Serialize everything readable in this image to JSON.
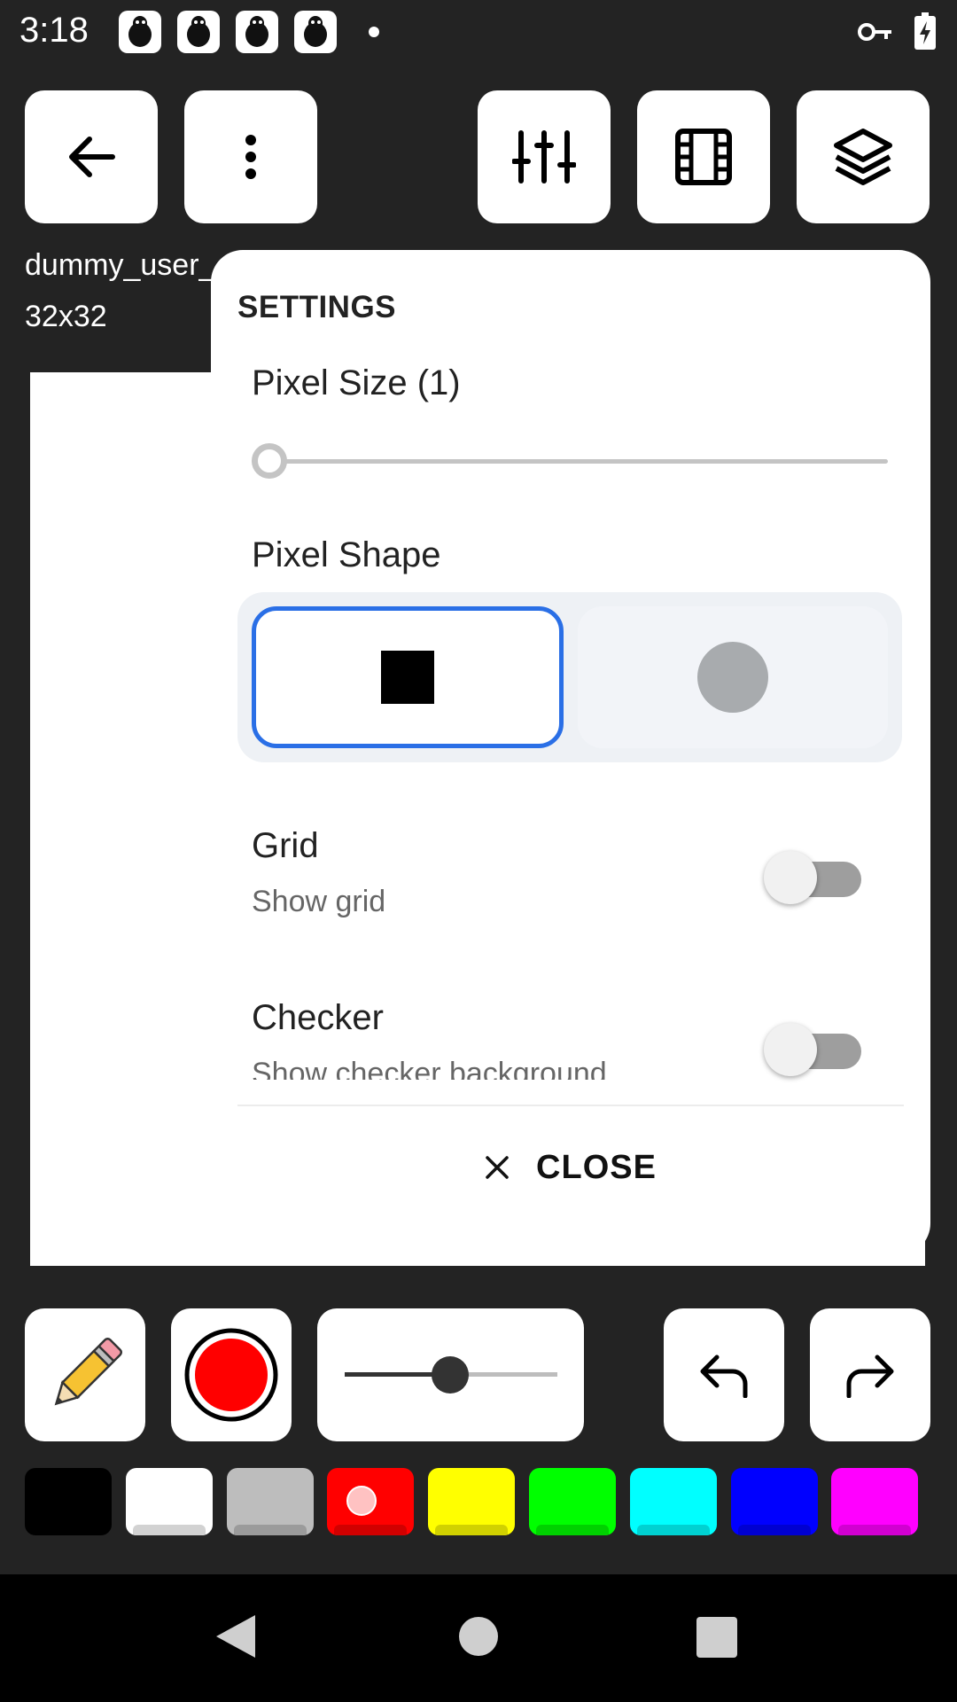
{
  "status_bar": {
    "time": "3:18",
    "notification_icons": [
      "bug-icon",
      "bug-icon",
      "bug-icon",
      "bug-icon"
    ],
    "right_icons": [
      "vpn-key-icon",
      "battery-charging-icon"
    ]
  },
  "top_toolbar": {
    "buttons": [
      "back-arrow-icon",
      "more-vert-icon",
      "tune-sliders-icon",
      "film-frames-icon",
      "layers-icon"
    ]
  },
  "canvas": {
    "file_name": "dummy_user_",
    "size": "32x32"
  },
  "settings": {
    "title": "SETTINGS",
    "pixel_size_label": "Pixel Size (1)",
    "pixel_size_value": 1,
    "pixel_shape_label": "Pixel Shape",
    "pixel_shape_options": [
      "square",
      "circle"
    ],
    "pixel_shape_selected": "square",
    "grid": {
      "title": "Grid",
      "subtitle": "Show grid",
      "enabled": false
    },
    "checker": {
      "title": "Checker",
      "subtitle": "Show checker background",
      "enabled": false
    },
    "close_label": "CLOSE",
    "accent_color": "#2a6fe6"
  },
  "bottom_toolbar": {
    "tool": "pencil-icon",
    "current_color": "#ff0000",
    "brush_size_fraction": 0.5,
    "undo": "undo-icon",
    "redo": "redo-icon"
  },
  "palette": {
    "colors": [
      "#000000",
      "#ffffff",
      "#bdbdbd",
      "#ff0000",
      "#ffff00",
      "#00ff00",
      "#00ffff",
      "#0000ff",
      "#ff00ff"
    ],
    "selected_index": 3
  },
  "nav_bar": {
    "buttons": [
      "nav-back-icon",
      "nav-home-icon",
      "nav-recents-icon"
    ]
  }
}
